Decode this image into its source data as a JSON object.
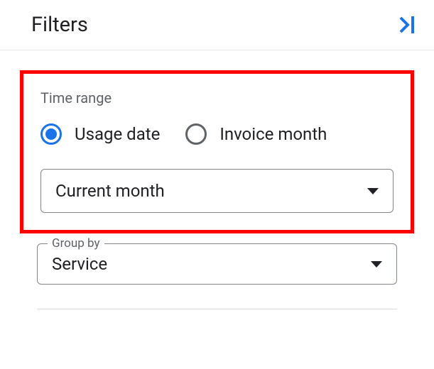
{
  "header": {
    "title": "Filters"
  },
  "timeRange": {
    "label": "Time range",
    "options": {
      "usageDate": "Usage date",
      "invoiceMonth": "Invoice month"
    },
    "selectedPeriod": "Current month"
  },
  "groupBy": {
    "label": "Group by",
    "value": "Service"
  }
}
